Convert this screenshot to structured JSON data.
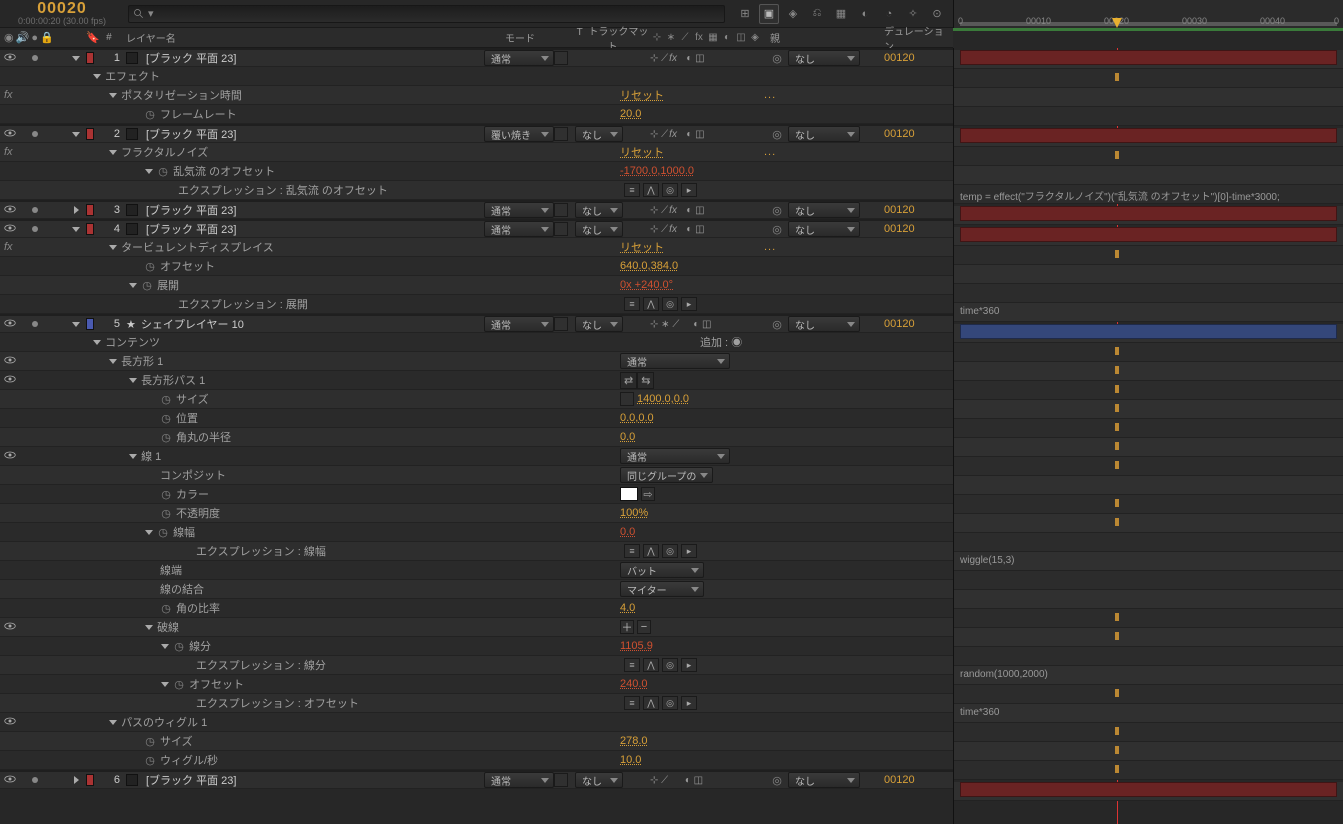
{
  "timecode": {
    "main": "00020",
    "sub": "0:00:00:20 (30.00 fps)"
  },
  "search": {
    "placeholder": ""
  },
  "headers": {
    "layer_name": "レイヤー名",
    "mode": "モード",
    "trkmat_t": "T",
    "trkmat": "トラックマット",
    "parent": "親",
    "duration": "デュレーション"
  },
  "ruler": {
    "t0": "0",
    "t10": "00010",
    "t20": "00020",
    "t30": "00030",
    "t40": "00040",
    "tend": "0"
  },
  "dropdown": {
    "normal": "通常",
    "screen": "覆い焼き",
    "none": "なし",
    "butt": "バット",
    "miter": "マイター",
    "samegroup": "同じグループの"
  },
  "labels": {
    "effects": "エフェクト",
    "posterize_time": "ポスタリゼーション時間",
    "frame_rate": "フレームレート",
    "reset": "リセット",
    "dots": "...",
    "fractal_noise": "フラクタルノイズ",
    "turb_offset": "乱気流 のオフセット",
    "expr_turb": "エクスプレッション : 乱気流 のオフセット",
    "turb_displace": "タービュレントディスプレイス",
    "offset": "オフセット",
    "evolution": "展開",
    "expr_evolution": "エクスプレッション : 展開",
    "contents": "コンテンツ",
    "add": "追加 :",
    "rect1": "長方形 1",
    "rectpath1": "長方形パス 1",
    "size": "サイズ",
    "position": "位置",
    "roundness": "角丸の半径",
    "stroke1": "線 1",
    "composite": "コンポジット",
    "color": "カラー",
    "opacity": "不透明度",
    "stroke_w": "線幅",
    "expr_stroke_w": "エクスプレッション : 線幅",
    "line_cap": "線端",
    "line_join": "線の結合",
    "miter_limit": "角の比率",
    "dashes": "破線",
    "dash": "線分",
    "expr_dash": "エクスプレッション : 線分",
    "dash_offset": "オフセット",
    "expr_dash_offset": "エクスプレッション : オフセット",
    "path_wiggle": "パスのウィグル 1",
    "wiggle_sec": "ウィグル/秒"
  },
  "layers": {
    "l1": {
      "idx": "1",
      "name": "[ブラック 平面 23]",
      "dur": "00120"
    },
    "l2": {
      "idx": "2",
      "name": "[ブラック 平面 23]",
      "dur": "00120"
    },
    "l3": {
      "idx": "3",
      "name": "[ブラック 平面 23]",
      "dur": "00120"
    },
    "l4": {
      "idx": "4",
      "name": "[ブラック 平面 23]",
      "dur": "00120"
    },
    "l5": {
      "idx": "5",
      "name": "シェイプレイヤー 10",
      "dur": "00120"
    },
    "l6": {
      "idx": "6",
      "name": "[ブラック 平面 23]",
      "dur": "00120"
    }
  },
  "values": {
    "frame_rate": "20.0",
    "turb_offset": "-1700.0,1000.0",
    "td_offset": "640.0,384.0",
    "evolution": "0x +240.0°",
    "rect_size": "1400.0,0.0",
    "rect_pos": "0.0,0.0",
    "roundness": "0.0",
    "opacity": "100%",
    "stroke_w": "0.0",
    "miter": "4.0",
    "dash": "1105.9",
    "dash_off": "240.0",
    "wiggle_size": "278.0",
    "wiggle_sec": "10.0"
  },
  "expr": {
    "turb": "temp = effect(\"フラクタルノイズ\")(\"乱気流 のオフセット\")[0]-time*3000;",
    "evolution": "time*360",
    "stroke_w": "wiggle(15,3)",
    "dash": "random(1000,2000)",
    "dash_off": "time*360"
  }
}
